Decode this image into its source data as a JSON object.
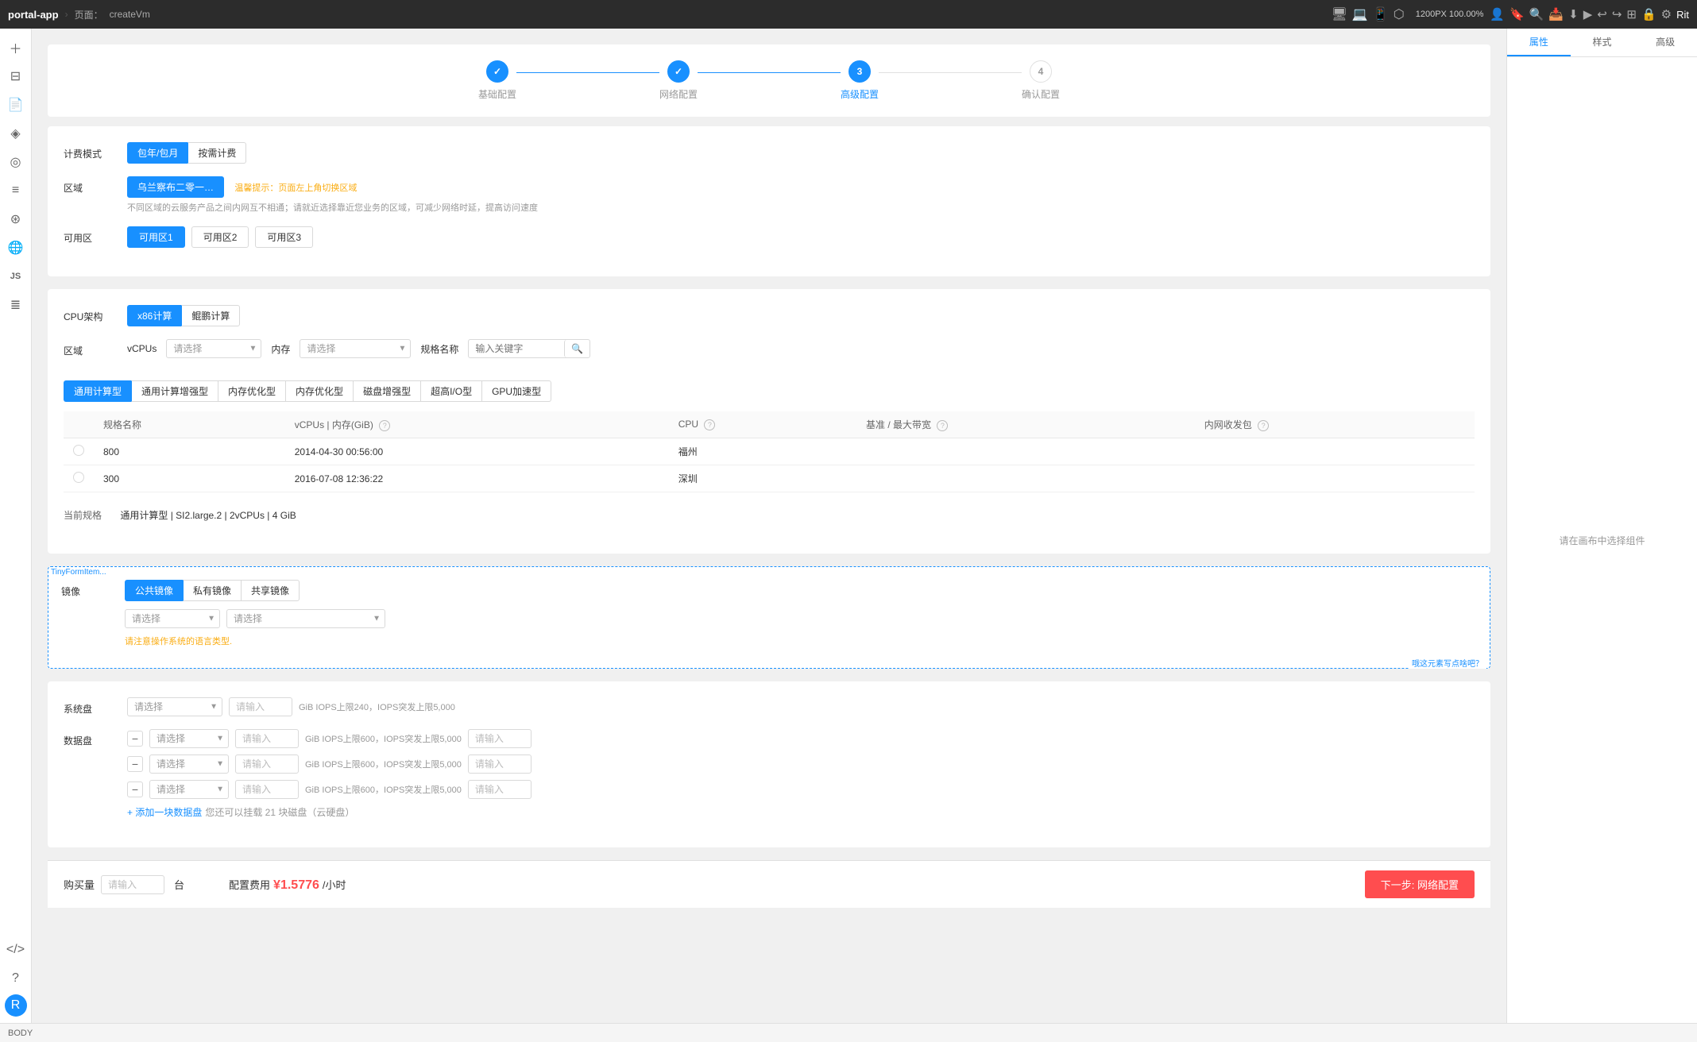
{
  "app": {
    "name": "portal-app",
    "page_label": "页面：",
    "page_name": "createVm",
    "zoom": "1200PX  100.00%",
    "status_bar": "BODY"
  },
  "right_panel": {
    "tabs": [
      "属性",
      "样式",
      "高级"
    ],
    "active_tab": "属性",
    "empty_text": "请在画布中选择组件"
  },
  "steps": [
    {
      "number": "✓",
      "label": "基础配置",
      "state": "done"
    },
    {
      "number": "✓",
      "label": "网络配置",
      "state": "done"
    },
    {
      "number": "3",
      "label": "高级配置",
      "state": "active"
    },
    {
      "number": "4",
      "label": "确认配置",
      "state": "pending"
    }
  ],
  "billing": {
    "label": "计费模式",
    "options": [
      "包年/包月",
      "按需计费"
    ],
    "active": "包年/包月"
  },
  "region": {
    "label": "区域",
    "selected": "乌兰察布二零一…",
    "tooltip": "温馨提示：页面左上角切换区域",
    "info": "不同区域的云服务产品之间内网互不相通；请就近选择靠近您业务的区域，可减少网络时延，提高访问速度"
  },
  "az": {
    "label": "可用区",
    "options": [
      "可用区1",
      "可用区2",
      "可用区3"
    ],
    "active": "可用区1"
  },
  "cpu": {
    "label": "CPU架构",
    "options": [
      "x86计算",
      "鲲鹏计算"
    ],
    "active": "x86计算"
  },
  "spec_filter": {
    "label": "区域",
    "vcpus_label": "vCPUs",
    "vcpus_placeholder": "请选择",
    "memory_label": "内存",
    "memory_placeholder": "请选择",
    "spec_name_label": "规格名称",
    "spec_name_placeholder": "输入关键字",
    "search_icon": "🔍"
  },
  "spec_types": [
    "通用计算型",
    "通用计算增强型",
    "内存优化型",
    "内存优化型",
    "磁盘增强型",
    "超高I/O型",
    "GPU加速型"
  ],
  "spec_table": {
    "headers": [
      "规格名称",
      "vCPUs | 内存(GiB)",
      "CPU",
      "基准 / 最大带宽",
      "内网收发包"
    ],
    "rows": [
      {
        "name": "800",
        "vcpus_memory": "2014-04-30 00:56:00",
        "cpu": "福州",
        "bandwidth": "",
        "network": ""
      },
      {
        "name": "300",
        "vcpus_memory": "2016-07-08 12:36:22",
        "cpu": "深圳",
        "bandwidth": "",
        "network": ""
      }
    ]
  },
  "current_spec": {
    "label": "当前规格",
    "value": "通用计算型 | SI2.large.2 | 2vCPUs | 4 GiB"
  },
  "image": {
    "label": "镜像",
    "tiny_label": "TinyFormItem...",
    "tabs": [
      "公共镜像",
      "私有镜像",
      "共享镜像"
    ],
    "active_tab": "公共镜像",
    "dropdown1_placeholder": "请选择",
    "dropdown2_placeholder": "请选择",
    "warning": "请注意操作系统的语言类型.",
    "hint": "哦这元素写点啥吧？"
  },
  "system_disk": {
    "label": "系统盘",
    "type_placeholder": "请选择",
    "size_placeholder": "请输入",
    "info": "GiB IOPS上限240，IOPS突发上限5,000"
  },
  "data_disk": {
    "label": "数据盘",
    "rows": [
      {
        "type_placeholder": "请选择",
        "size_placeholder": "请输入",
        "info": "GiB IOPS上限600，IOPS突发上限5,000",
        "extra_placeholder": "请输入"
      },
      {
        "type_placeholder": "请选择",
        "size_placeholder": "请输入",
        "info": "GiB IOPS上限600，IOPS突发上限5,000",
        "extra_placeholder": "请输入"
      },
      {
        "type_placeholder": "请选择",
        "size_placeholder": "请输入",
        "info": "GiB IOPS上限600，IOPS突发上限5,000",
        "extra_placeholder": "请输入"
      }
    ],
    "add_label": "+ 添加一块数据盘",
    "add_hint": "您还可以挂载 21 块磁盘（云硬盘）"
  },
  "purchase": {
    "label": "购买量",
    "placeholder": "请输入",
    "unit": "台",
    "price_label": "配置费用",
    "price": "¥1.5776",
    "per": "/小时",
    "next_button": "下一步: 网络配置"
  },
  "left_sidebar": {
    "icons": [
      "⊕",
      "⊟",
      "⊞",
      "◈",
      "◎",
      "≡",
      "⊛",
      "⊙",
      "JS",
      "≣"
    ]
  }
}
